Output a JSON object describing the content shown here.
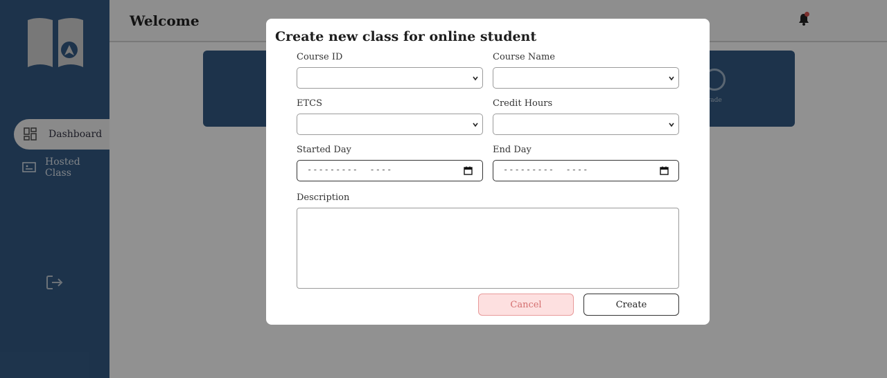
{
  "sidebar": {
    "logo_icon": "open-book-logo",
    "items": [
      {
        "label": "Dashboard",
        "icon": "dashboard-grid-icon",
        "active": true
      },
      {
        "label": "Hosted Class",
        "icon": "presentation-board-icon",
        "active": false
      }
    ],
    "logout_icon": "logout-icon"
  },
  "header": {
    "title": "Welcome",
    "notification_icon": "bell-icon"
  },
  "dashboard_card": {
    "label": "rade"
  },
  "modal": {
    "title": "Create new class for online student",
    "fields": {
      "course_id": {
        "label": "Course ID",
        "value": ""
      },
      "course_name": {
        "label": "Course Name",
        "value": ""
      },
      "etcs": {
        "label": "ETCS",
        "value": ""
      },
      "credit_hours": {
        "label": "Credit Hours",
        "value": ""
      },
      "started_day": {
        "label": "Started Day",
        "placeholder": "---------  ----"
      },
      "end_day": {
        "label": "End Day",
        "placeholder": "---------  ----"
      },
      "description": {
        "label": "Description",
        "value": ""
      }
    },
    "cancel_label": "Cancel",
    "create_label": "Create"
  },
  "colors": {
    "sidebar_bg": "#345b85",
    "cancel_bg": "#fde0e0",
    "cancel_text": "#d46f6f",
    "notification_dot": "#d9534f"
  }
}
